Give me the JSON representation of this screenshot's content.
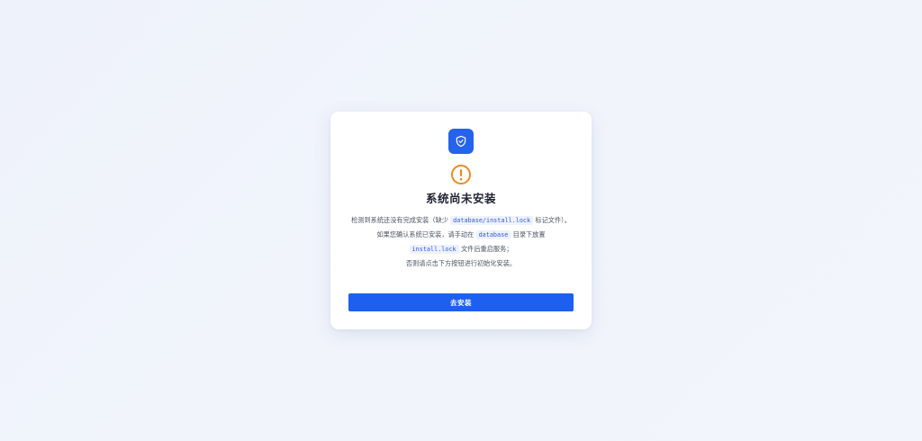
{
  "card": {
    "icons": {
      "badge": "shield-check-icon",
      "status": "warning-circle-icon"
    },
    "title": "系统尚未安装",
    "line1": {
      "pre": "检测到系统还没有完成安装（缺少 ",
      "code": "database/install.lock",
      "post": " 标记文件）。"
    },
    "line2": {
      "pre": "如果您确认系统已安装，请手动在 ",
      "code1": "database",
      "mid": " 目录下放置 ",
      "code2": "install.lock",
      "post": " 文件后重启服务；"
    },
    "line3": "否则请点击下方按钮进行初始化安装。",
    "button_label": "去安装"
  },
  "colors": {
    "primary": "#1d5ff0",
    "warning": "#f08a1d",
    "code_text": "#2f5bd8",
    "code_bg": "#eef2fd"
  }
}
